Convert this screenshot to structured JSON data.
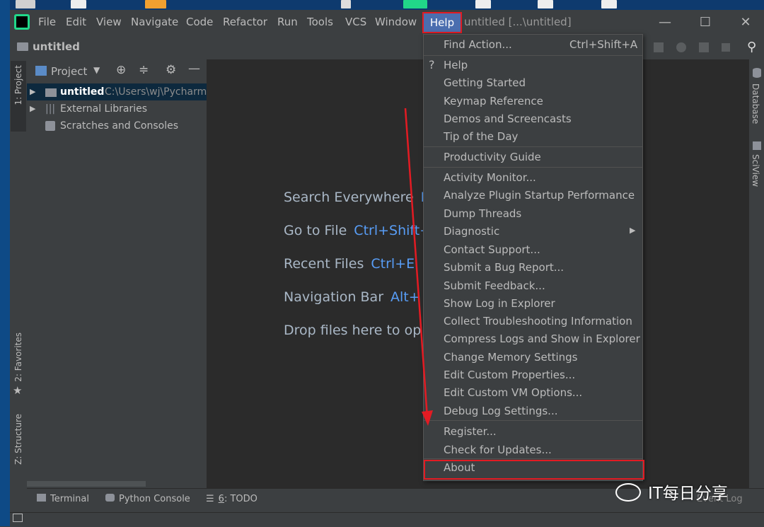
{
  "menu": {
    "items": [
      "File",
      "Edit",
      "View",
      "Navigate",
      "Code",
      "Refactor",
      "Run",
      "Tools",
      "VCS",
      "Window"
    ],
    "help": "Help"
  },
  "window": {
    "title": "untitled [...\\untitled]",
    "minimize": "—",
    "maximize": "☐",
    "close": "✕"
  },
  "breadcrumb": {
    "project": "untitled"
  },
  "sidebar_left": {
    "project_tab": "1: Project",
    "favorites_tab": "2: Favorites",
    "structure_tab": "Z: Structure"
  },
  "project_panel": {
    "title": "Project",
    "tree": [
      {
        "label": "untitled",
        "path": "C:\\Users\\wj\\Pycharm"
      },
      {
        "label": "External Libraries"
      },
      {
        "label": "Scratches and Consoles"
      }
    ]
  },
  "editor_hints": [
    {
      "label": "Search Everywhere",
      "key": "D"
    },
    {
      "label": "Go to File",
      "key": "Ctrl+Shift+"
    },
    {
      "label": "Recent Files",
      "key": "Ctrl+E"
    },
    {
      "label": "Navigation Bar",
      "key": "Alt+"
    },
    {
      "label": "Drop files here to op",
      "key": ""
    }
  ],
  "sidebar_right": {
    "database": "Database",
    "sciview": "SciView"
  },
  "bottom_tabs": {
    "terminal": "Terminal",
    "python_console": "Python Console",
    "todo_prefix": "6",
    "todo": ": TODO",
    "event_log": "Event Log"
  },
  "help_dropdown": {
    "find_action": "Find Action...",
    "find_action_shortcut": "Ctrl+Shift+A",
    "items": [
      "Help",
      "Getting Started",
      "Keymap Reference",
      "Demos and Screencasts",
      "Tip of the Day",
      "Productivity Guide",
      "Activity Monitor...",
      "Analyze Plugin Startup Performance",
      "Dump Threads",
      "Diagnostic",
      "Contact Support...",
      "Submit a Bug Report...",
      "Submit Feedback...",
      "Show Log in Explorer",
      "Collect Troubleshooting Information",
      "Compress Logs and Show in Explorer",
      "Change Memory Settings",
      "Edit Custom Properties...",
      "Edit Custom VM Options...",
      "Debug Log Settings...",
      "Register...",
      "Check for Updates...",
      "About"
    ]
  },
  "watermark": "IT每日分享",
  "colors": {
    "accent": "#4b6eaf",
    "highlight": "#e31b23",
    "key": "#589df6"
  }
}
